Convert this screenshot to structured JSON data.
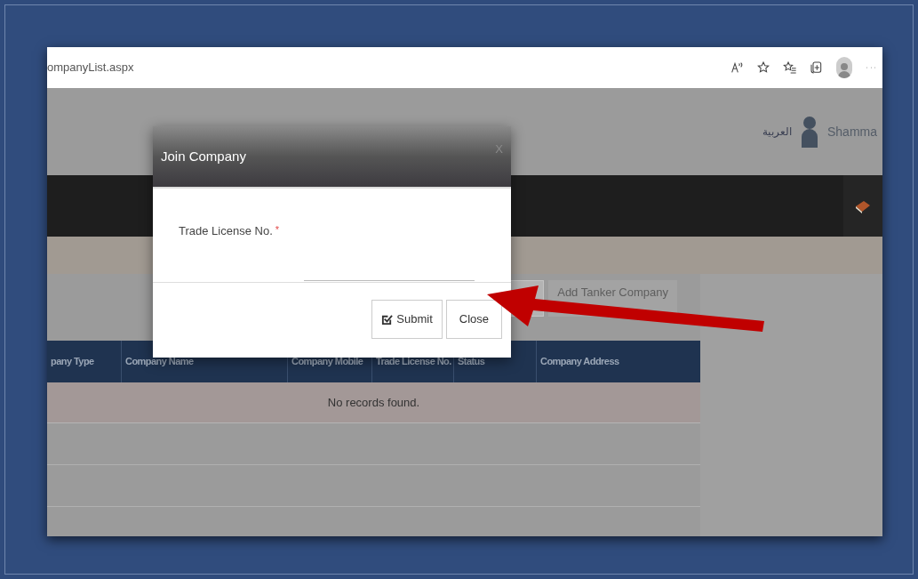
{
  "browser": {
    "url": "ompanyList.aspx"
  },
  "header": {
    "language_link": "العربية",
    "user_name": "Shamma"
  },
  "toolbar": {
    "buttons": [
      "Add Tanker Company"
    ]
  },
  "table": {
    "columns": [
      "pany Type",
      "Company Name",
      "Company Mobile",
      "Trade License No.",
      "Status",
      "Company Address"
    ],
    "empty_message": "No records found."
  },
  "dialog": {
    "title": "Join Company",
    "close": "X",
    "field": {
      "label": "Trade License No.",
      "required": true,
      "required_mark": "*"
    },
    "buttons": [
      {
        "label": "Submit",
        "kind": "submit"
      },
      {
        "label": "Close",
        "kind": "plain"
      }
    ]
  },
  "annotation": {
    "kind": "arrow"
  }
}
